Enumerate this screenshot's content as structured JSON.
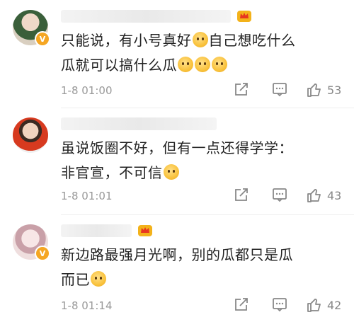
{
  "comments": [
    {
      "text_lines": [
        "只能说，有小号真好",
        "自己想吃什么",
        "瓜就可以搞什么瓜"
      ],
      "time": "1-8 01:00",
      "likes": "53"
    },
    {
      "text_lines": [
        "虽说饭圈不好，但有一点还得学学：",
        "非官宣，不可信"
      ],
      "time": "1-8 01:01",
      "likes": "43"
    },
    {
      "text_lines": [
        "新边路最强月光啊，别的瓜都只是瓜",
        "而已"
      ],
      "time": "1-8 01:14",
      "likes": "42"
    }
  ],
  "icons": [
    "verified-icon",
    "crown-icon",
    "emoji-icon",
    "share-icon",
    "reply-icon",
    "like-icon"
  ],
  "colors": {
    "verified": "#f5a623",
    "text": "#222222",
    "meta": "#999999"
  }
}
